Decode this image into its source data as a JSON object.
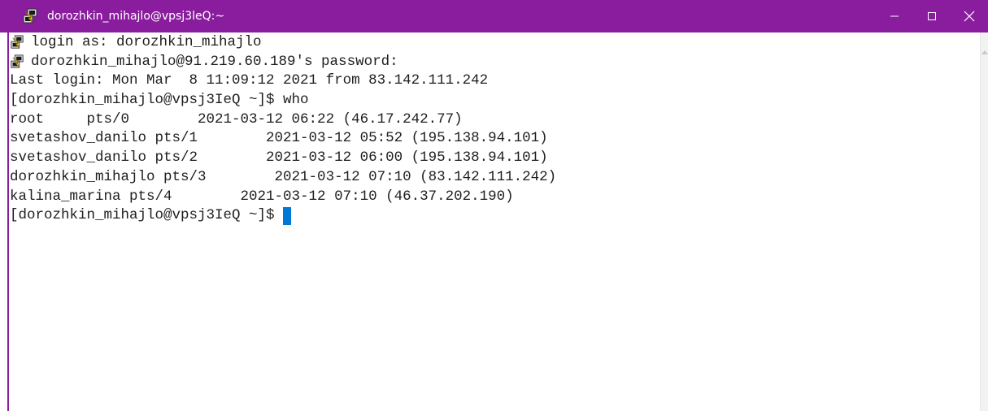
{
  "window": {
    "title": "dorozhkin_mihajlo@vpsj3leQ:~",
    "titlebar_color": "#8a1d9e",
    "icons": {
      "app": "putty-icon",
      "minimize": "minimize-icon",
      "maximize": "maximize-icon",
      "close": "close-icon"
    }
  },
  "terminal": {
    "text_color": "#1e1e1e",
    "cursor_color": "#0078d7",
    "lines": [
      {
        "icon": "putty-icon",
        "text": "login as: dorozhkin_mihajlo"
      },
      {
        "icon": "putty-icon",
        "text": "dorozhkin_mihajlo@91.219.60.189's password:"
      },
      {
        "icon": "",
        "text": "Last login: Mon Mar  8 11:09:12 2021 from 83.142.111.242"
      },
      {
        "icon": "",
        "text": "[dorozhkin_mihajlo@vpsj3IeQ ~]$ who"
      },
      {
        "icon": "",
        "text": "root     pts/0        2021-03-12 06:22 (46.17.242.77)"
      },
      {
        "icon": "",
        "text": "svetashov_danilo pts/1        2021-03-12 05:52 (195.138.94.101)"
      },
      {
        "icon": "",
        "text": "svetashov_danilo pts/2        2021-03-12 06:00 (195.138.94.101)"
      },
      {
        "icon": "",
        "text": "dorozhkin_mihajlo pts/3        2021-03-12 07:10 (83.142.111.242)"
      },
      {
        "icon": "",
        "text": "kalina_marina pts/4        2021-03-12 07:10 (46.37.202.190)"
      },
      {
        "icon": "",
        "text": "[dorozhkin_mihajlo@vpsj3IeQ ~]$ ",
        "cursor": true
      }
    ]
  }
}
